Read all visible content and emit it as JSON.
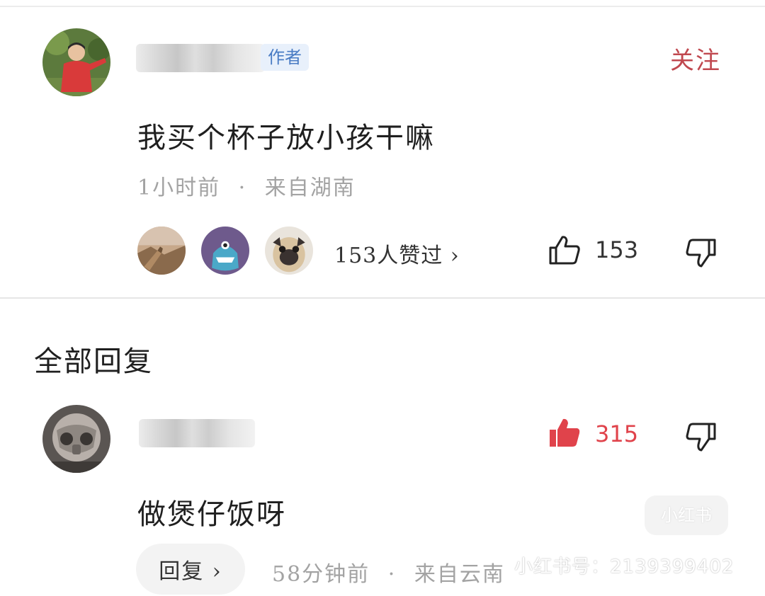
{
  "comment": {
    "author_badge": "作者",
    "follow_label": "关注",
    "text": "我买个杯子放小孩干嘛",
    "time": "1小时前",
    "location": "来自湖南",
    "likers_summary": "153人赞过 ›",
    "like_count": "153",
    "icons": {
      "like": "thumbs-up-outline-icon",
      "dislike": "thumbs-down-outline-icon"
    }
  },
  "replies_section": {
    "title": "全部回复"
  },
  "reply": {
    "text": "做煲仔饭呀",
    "like_count": "315",
    "time": "58分钟前",
    "location": "来自云南",
    "reply_button": "回复 ›",
    "icons": {
      "like": "thumbs-up-filled-icon",
      "dislike": "thumbs-down-outline-icon"
    },
    "like_color": "#e0434b"
  },
  "watermark": {
    "logo": "小红书",
    "id_text": "小红书号：2139399402"
  },
  "colors": {
    "follow": "#c0484f",
    "badge_bg": "#e8f0fb",
    "badge_text": "#4a7cc4",
    "meta": "#a3a3a3"
  }
}
